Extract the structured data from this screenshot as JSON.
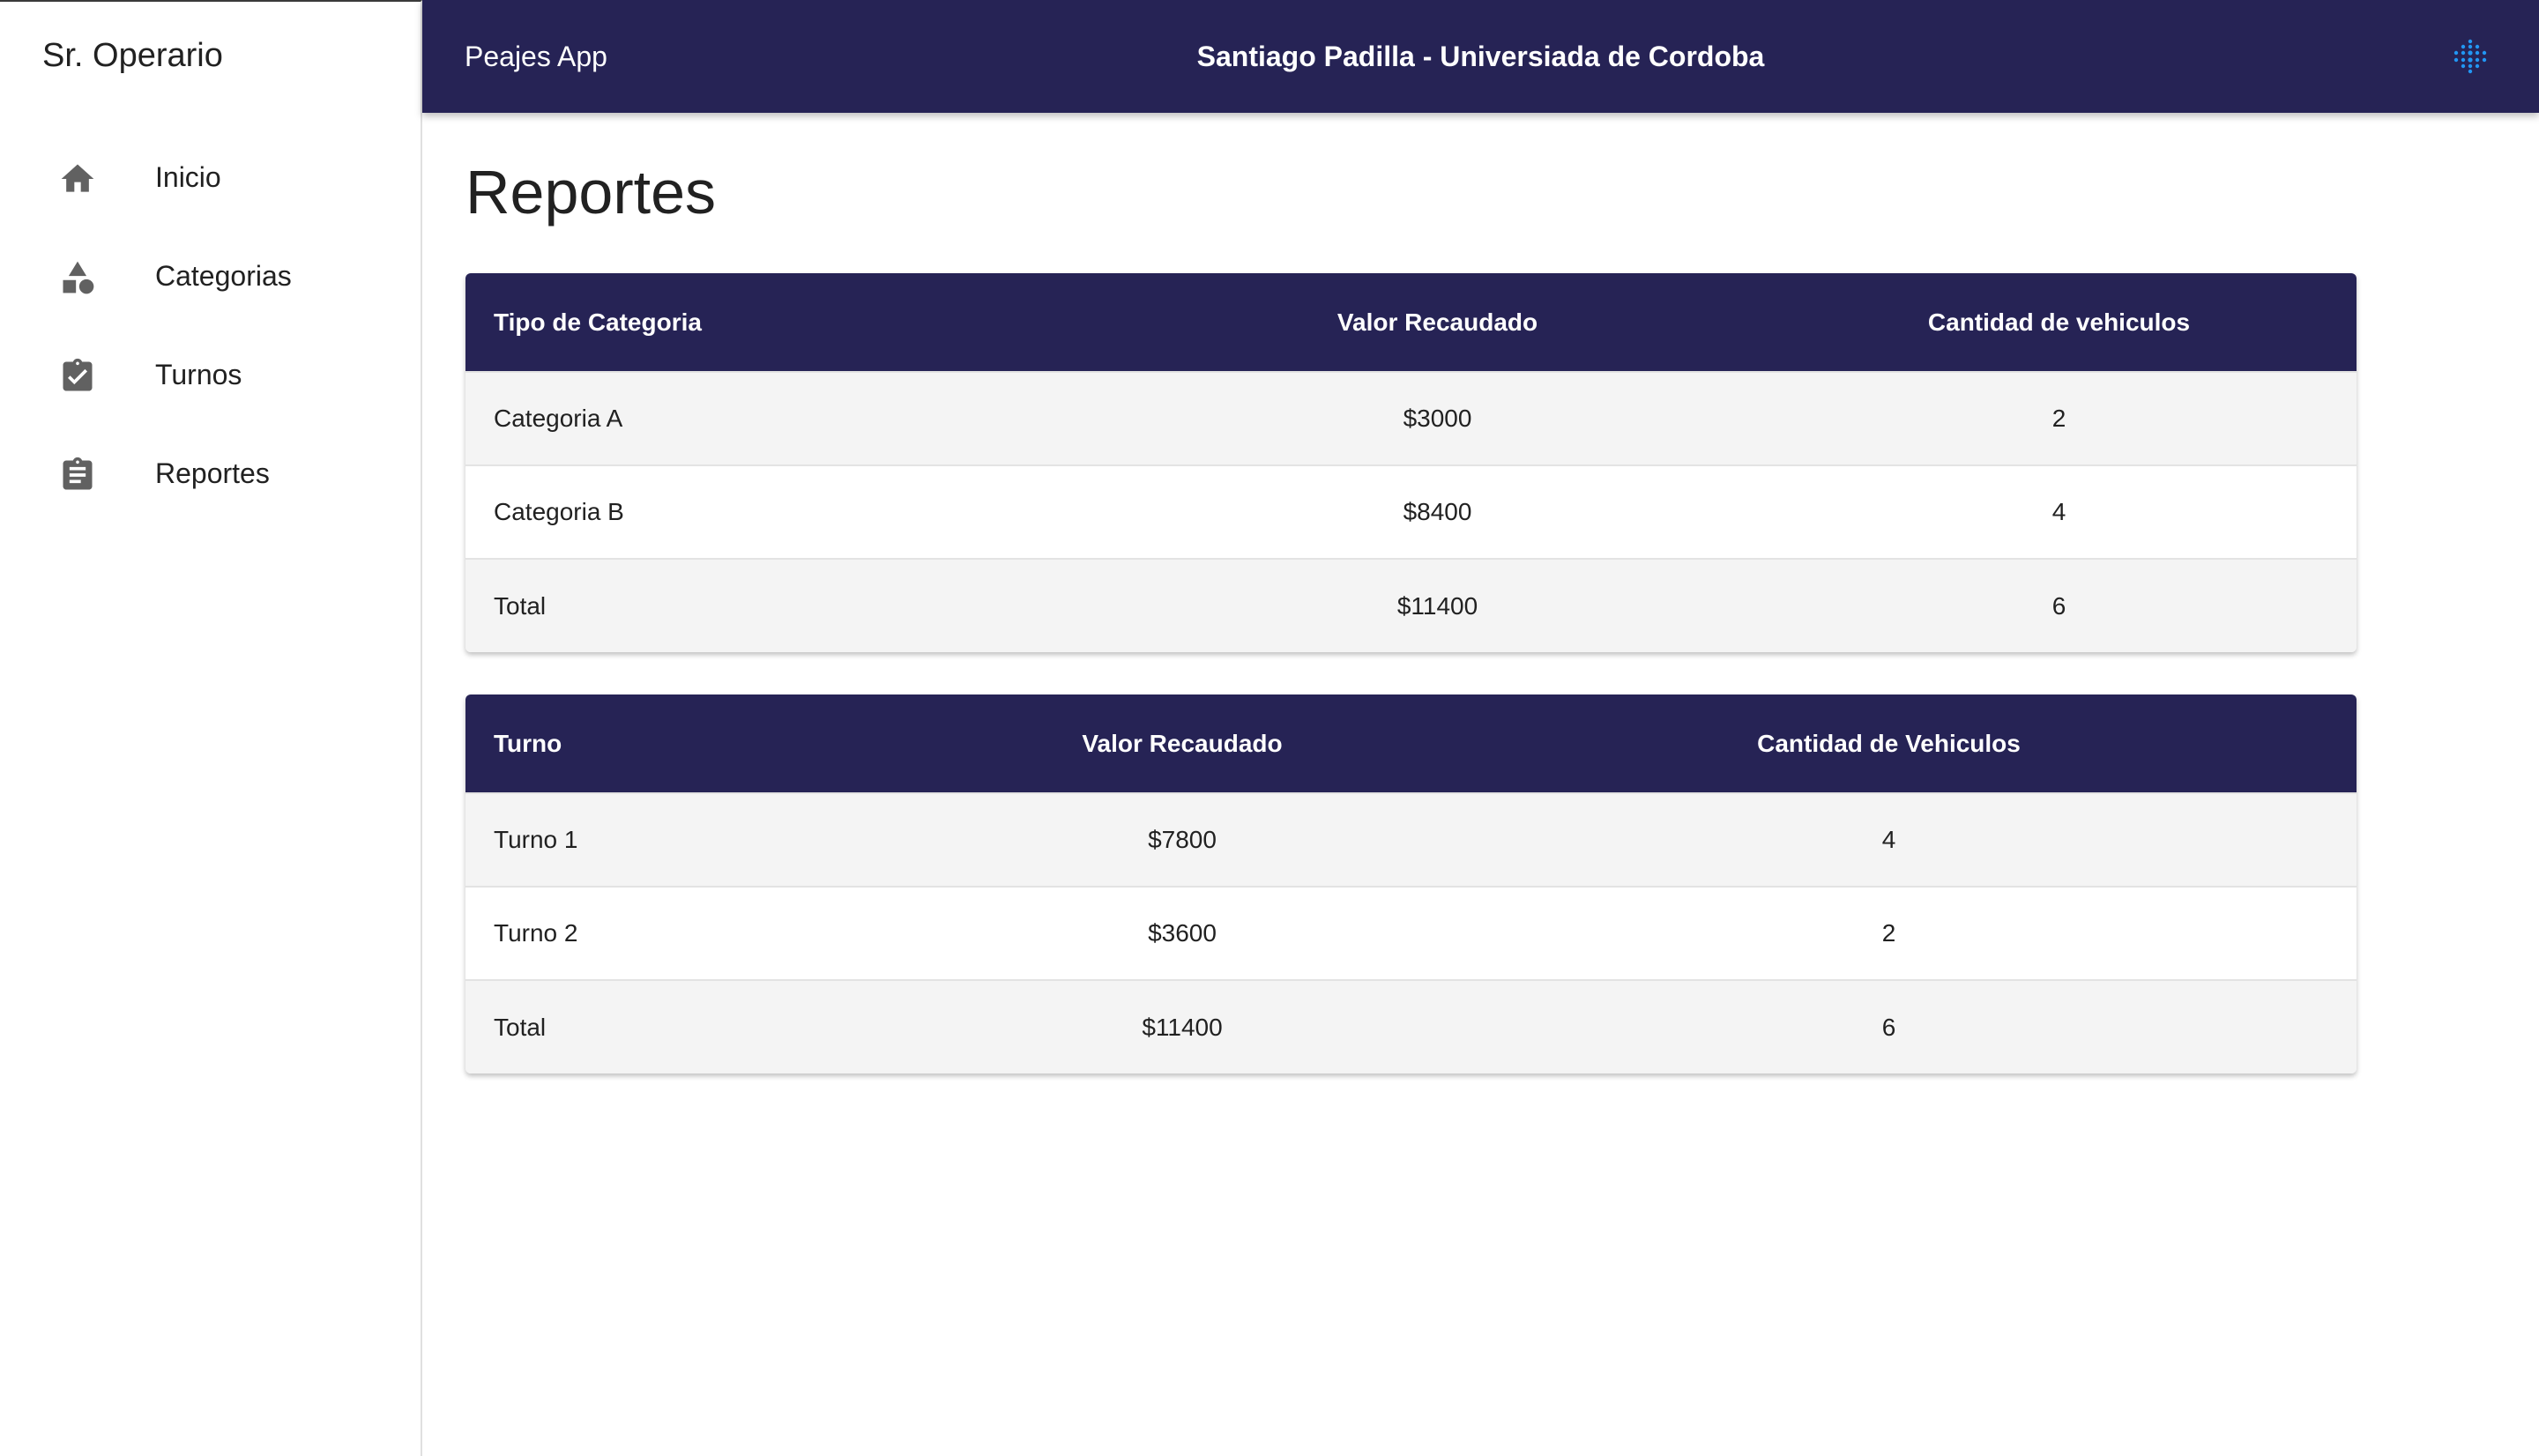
{
  "sidebar": {
    "title": "Sr. Operario",
    "items": [
      {
        "label": "Inicio",
        "icon": "home-icon"
      },
      {
        "label": "Categorias",
        "icon": "category-icon"
      },
      {
        "label": "Turnos",
        "icon": "assignment-turned-in-icon"
      },
      {
        "label": "Reportes",
        "icon": "assignment-icon"
      }
    ]
  },
  "header": {
    "app_name": "Peajes App",
    "center_text": "Santiago Padilla - Universiada de Cordoba",
    "logo_icon": "dots-logo-icon",
    "logo_color": "#2196f3"
  },
  "main": {
    "title": "Reportes",
    "category_table": {
      "headers": [
        "Tipo de Categoria",
        "Valor Recaudado",
        "Cantidad de vehiculos"
      ],
      "rows": [
        [
          "Categoria A",
          "$3000",
          "2"
        ],
        [
          "Categoria B",
          "$8400",
          "4"
        ],
        [
          "Total",
          "$11400",
          "6"
        ]
      ]
    },
    "shift_table": {
      "headers": [
        "Turno",
        "Valor Recaudado",
        "Cantidad de Vehiculos"
      ],
      "rows": [
        [
          "Turno 1",
          "$7800",
          "4"
        ],
        [
          "Turno 2",
          "$3600",
          "2"
        ],
        [
          "Total",
          "$11400",
          "6"
        ]
      ]
    }
  },
  "colors": {
    "primary": "#262355",
    "row_alt": "#f4f4f4",
    "icon_gray": "#616161"
  }
}
